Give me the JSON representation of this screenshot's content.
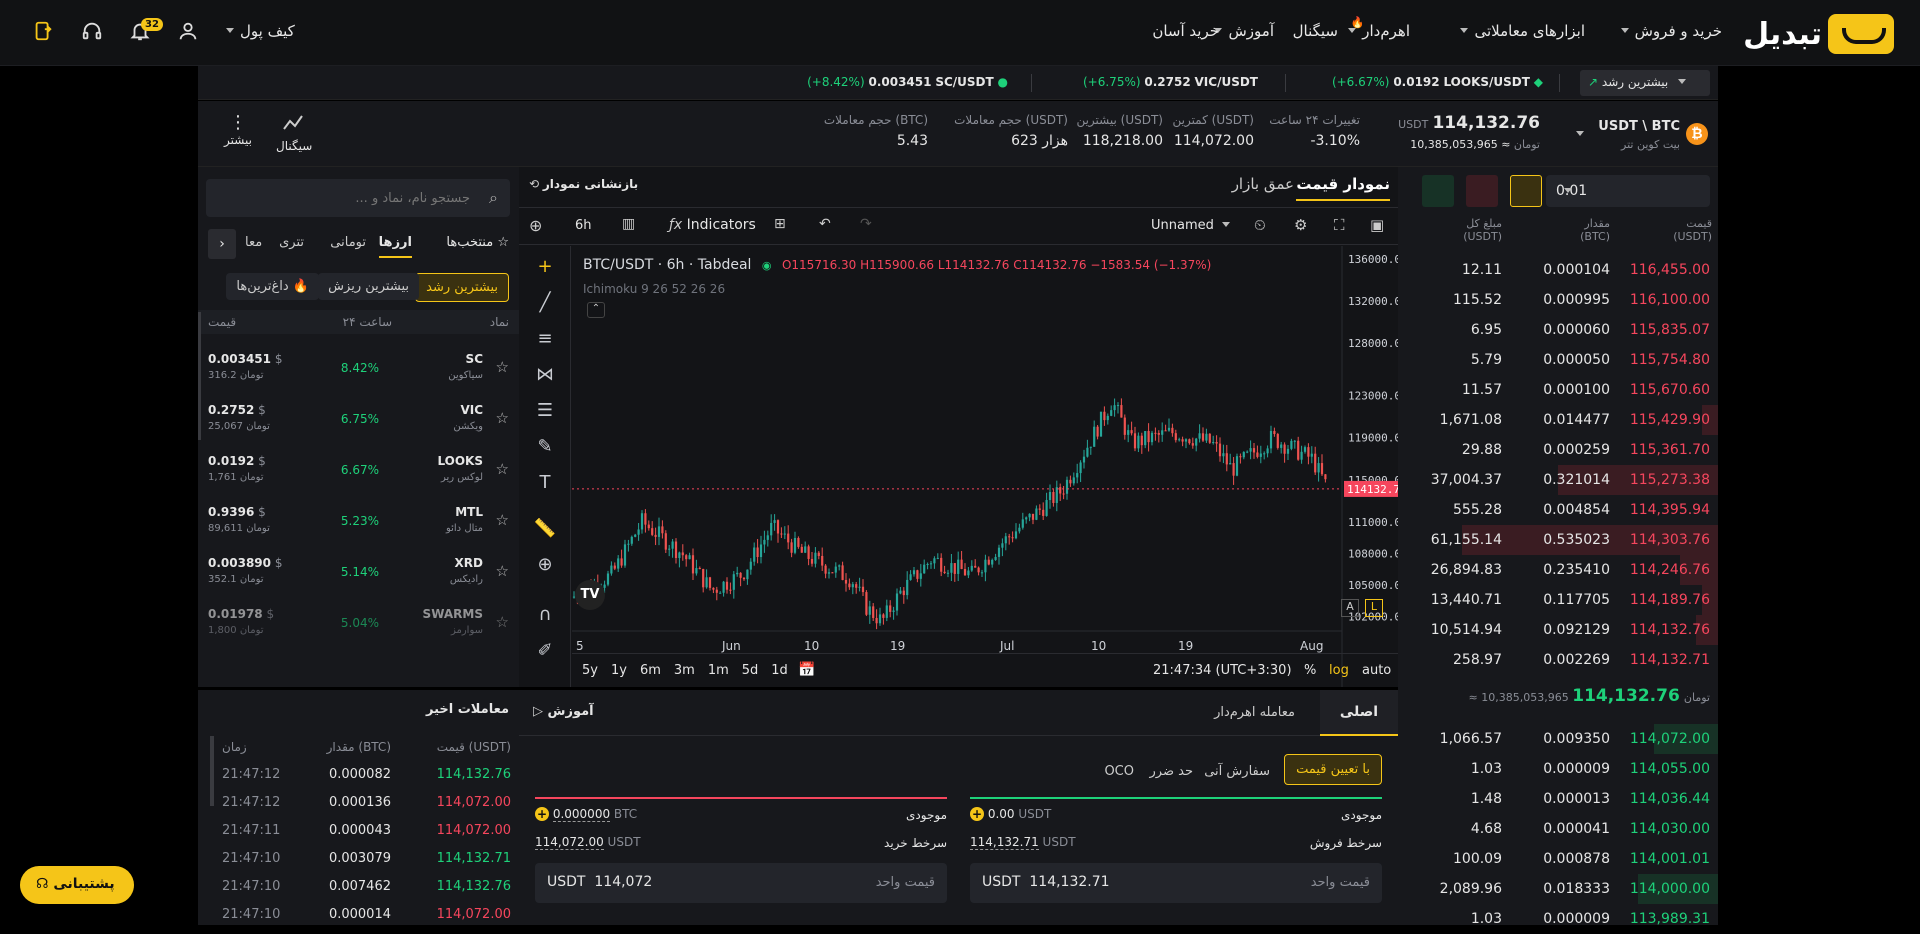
{
  "topbar": {
    "brand": "تبدیل",
    "nav": [
      "خرید و فروش",
      "ابزارهای معاملاتی",
      "اهرم‌دار",
      "سیگنال",
      "آموزش",
      "خرید آسان"
    ],
    "wallet": "کیف پول",
    "notif_count": "32"
  },
  "ticker": {
    "dropdown": "بیشترین رشد",
    "items": [
      {
        "pair": "LOOKS/USDT",
        "price": "0.0192",
        "change": "(+6.67%)"
      },
      {
        "pair": "VIC/USDT",
        "price": "0.2752",
        "change": "(+6.75%)"
      },
      {
        "pair": "SC/USDT",
        "price": "0.003451",
        "change": "(+8.42%)"
      }
    ]
  },
  "info": {
    "pair": "USDT \\ BTC",
    "pair_name": "بیت کوین تتر",
    "price": "114,132.76",
    "price_unit": "USDT",
    "toman": "≈ 10,385,053,965",
    "toman_unit": "تومان",
    "stats": [
      {
        "label": "تغییرات ۲۴ ساعت",
        "value": "-3.10%"
      },
      {
        "label": "کمترین (USDT)",
        "value": "114,072.00"
      },
      {
        "label": "بیشترین (USDT)",
        "value": "118,218.00"
      },
      {
        "label": "حجم معاملات (USDT)",
        "value": "623 هزار"
      },
      {
        "label": "حجم معاملات (BTC)",
        "value": "5.43"
      }
    ],
    "signal": "سیگنال",
    "more": "بیشتر"
  },
  "orderbook": {
    "step": "0.01",
    "headers": {
      "price": "قیمت",
      "price_unit": "(USDT)",
      "amount": "مقدار",
      "amount_unit": "(BTC)",
      "total": "مبلغ کل",
      "total_unit": "(USDT)"
    },
    "asks": [
      {
        "price": "116,455.00",
        "amount": "0.000104",
        "total": "12.11"
      },
      {
        "price": "116,100.00",
        "amount": "0.000995",
        "total": "115.52"
      },
      {
        "price": "115,835.07",
        "amount": "0.000060",
        "total": "6.95"
      },
      {
        "price": "115,754.80",
        "amount": "0.000050",
        "total": "5.79"
      },
      {
        "price": "115,670.60",
        "amount": "0.000100",
        "total": "11.57"
      },
      {
        "price": "115,429.90",
        "amount": "0.014477",
        "total": "1,671.08"
      },
      {
        "price": "115,361.70",
        "amount": "0.000259",
        "total": "29.88"
      },
      {
        "price": "115,273.38",
        "amount": "0.321014",
        "total": "37,004.37"
      },
      {
        "price": "114,395.94",
        "amount": "0.004854",
        "total": "555.28"
      },
      {
        "price": "114,303.76",
        "amount": "0.535023",
        "total": "61,155.14"
      },
      {
        "price": "114,246.76",
        "amount": "0.235410",
        "total": "26,894.83"
      },
      {
        "price": "114,189.76",
        "amount": "0.117705",
        "total": "13,440.71"
      },
      {
        "price": "114,132.76",
        "amount": "0.092129",
        "total": "10,514.94"
      },
      {
        "price": "114,132.71",
        "amount": "0.002269",
        "total": "258.97"
      }
    ],
    "mid_price": "114,132.76",
    "mid_toman": "≈ 10,385,053,965 تومان",
    "bids": [
      {
        "price": "114,072.00",
        "amount": "0.009350",
        "total": "1,066.57"
      },
      {
        "price": "114,055.00",
        "amount": "0.000009",
        "total": "1.03"
      },
      {
        "price": "114,036.44",
        "amount": "0.000013",
        "total": "1.48"
      },
      {
        "price": "114,030.00",
        "amount": "0.000041",
        "total": "4.68"
      },
      {
        "price": "114,001.01",
        "amount": "0.000878",
        "total": "100.09"
      },
      {
        "price": "114,000.00",
        "amount": "0.018333",
        "total": "2,089.96"
      },
      {
        "price": "113,989.31",
        "amount": "0.000009",
        "total": "1.03"
      }
    ]
  },
  "chart": {
    "tab_price": "نمودار قیمت",
    "tab_depth": "عمق بازار",
    "reset": "بازنشانی نمودار",
    "interval": "6h",
    "indicators": "Indicators",
    "layout_name": "Unnamed",
    "symbol": "BTC/USDT · 6h · Tabdeal",
    "ohlc": "O115716.30 H115900.66 L114132.76 C114132.76 −1583.54 (−1.37%)",
    "study": "Ichimoku 9 26 52 26 26",
    "last_price": "114132.76",
    "price_ticks": [
      "136000.00",
      "132000.00",
      "128000.00",
      "123000.00",
      "119000.00",
      "115000.00",
      "111000.00",
      "108000.00",
      "105000.00",
      "102000.00"
    ],
    "time_ticks": [
      "5",
      "Jun",
      "10",
      "19",
      "Jul",
      "10",
      "19",
      "Aug"
    ],
    "ranges": [
      "5y",
      "1y",
      "6m",
      "3m",
      "1m",
      "5d",
      "1d"
    ],
    "clock": "21:47:34 (UTC+3:30)",
    "scale_opts": [
      "%",
      "log",
      "auto"
    ],
    "scale_a": "A",
    "scale_l": "L"
  },
  "markets": {
    "search_placeholder": "جستجو نام، نماد و ...",
    "tabs": [
      "منتخب‌ها",
      "ارزها",
      "تومانی",
      "تتری",
      "معا"
    ],
    "filters": [
      "بیشترین رشد",
      "بیشترین ریزش",
      "داغ‌ترین‌ها"
    ],
    "headers": {
      "symbol": "نماد",
      "change": "۲۴ ساعت",
      "price": "قیمت"
    },
    "rows": [
      {
        "sym": "SC",
        "name": "سیاکوین",
        "change": "8.42%",
        "price": "0.003451",
        "toman": "316.2"
      },
      {
        "sym": "VIC",
        "name": "ویکشن",
        "change": "6.75%",
        "price": "0.2752",
        "toman": "25,067"
      },
      {
        "sym": "LOOKS",
        "name": "لوکس ریر",
        "change": "6.67%",
        "price": "0.0192",
        "toman": "1,761"
      },
      {
        "sym": "MTL",
        "name": "متال دائو",
        "change": "5.23%",
        "price": "0.9396",
        "toman": "89,611"
      },
      {
        "sym": "XRD",
        "name": "رادیکس",
        "change": "5.14%",
        "price": "0.003890",
        "toman": "352.1"
      },
      {
        "sym": "SWARMS",
        "name": "سوارمز",
        "change": "5.04%",
        "price": "0.01978",
        "toman": "1,800"
      }
    ],
    "dollar": "$",
    "toman_unit": "تومان"
  },
  "trades": {
    "title": "معاملات اخیر",
    "headers": {
      "price": "قیمت (USDT)",
      "amount": "مقدار (BTC)",
      "time": "زمان"
    },
    "rows": [
      {
        "price": "114,132.76",
        "amount": "0.000082",
        "time": "21:47:12",
        "side": "buy"
      },
      {
        "price": "114,072.00",
        "amount": "0.000136",
        "time": "21:47:12",
        "side": "sell"
      },
      {
        "price": "114,072.00",
        "amount": "0.000043",
        "time": "21:47:11",
        "side": "sell"
      },
      {
        "price": "114,132.71",
        "amount": "0.003079",
        "time": "21:47:10",
        "side": "buy"
      },
      {
        "price": "114,132.76",
        "amount": "0.007462",
        "time": "21:47:10",
        "side": "buy"
      },
      {
        "price": "114,072.00",
        "amount": "0.000014",
        "time": "21:47:10",
        "side": "sell"
      }
    ]
  },
  "order": {
    "tab_main": "اصلی",
    "tab_margin": "معامله اهرم‌دار",
    "tutorial": "آموزش",
    "types": [
      "با تعیین قیمت",
      "سفارش آنی",
      "حد ضرر",
      "OCO"
    ],
    "sell": {
      "balance_label": "موجودی",
      "balance": "0.00",
      "balance_unit": "USDT",
      "rate_label": "سرخط فروش",
      "rate": "114,132.71",
      "rate_unit": "USDT",
      "unit_label": "قیمت واحد",
      "unit_value": "114,132.71",
      "unit_cur": "USDT"
    },
    "buy": {
      "balance_label": "موجودی",
      "balance": "0.000000",
      "balance_unit": "BTC",
      "rate_label": "سرخط خرید",
      "rate": "114,072.00",
      "rate_unit": "USDT",
      "unit_label": "قیمت واحد",
      "unit_value": "114,072",
      "unit_cur": "USDT"
    }
  },
  "support": "پشتیبانی",
  "colors": {
    "accent": "#f5c518",
    "green": "#1ed17a",
    "red": "#f6465d",
    "bg": "#17181c"
  }
}
